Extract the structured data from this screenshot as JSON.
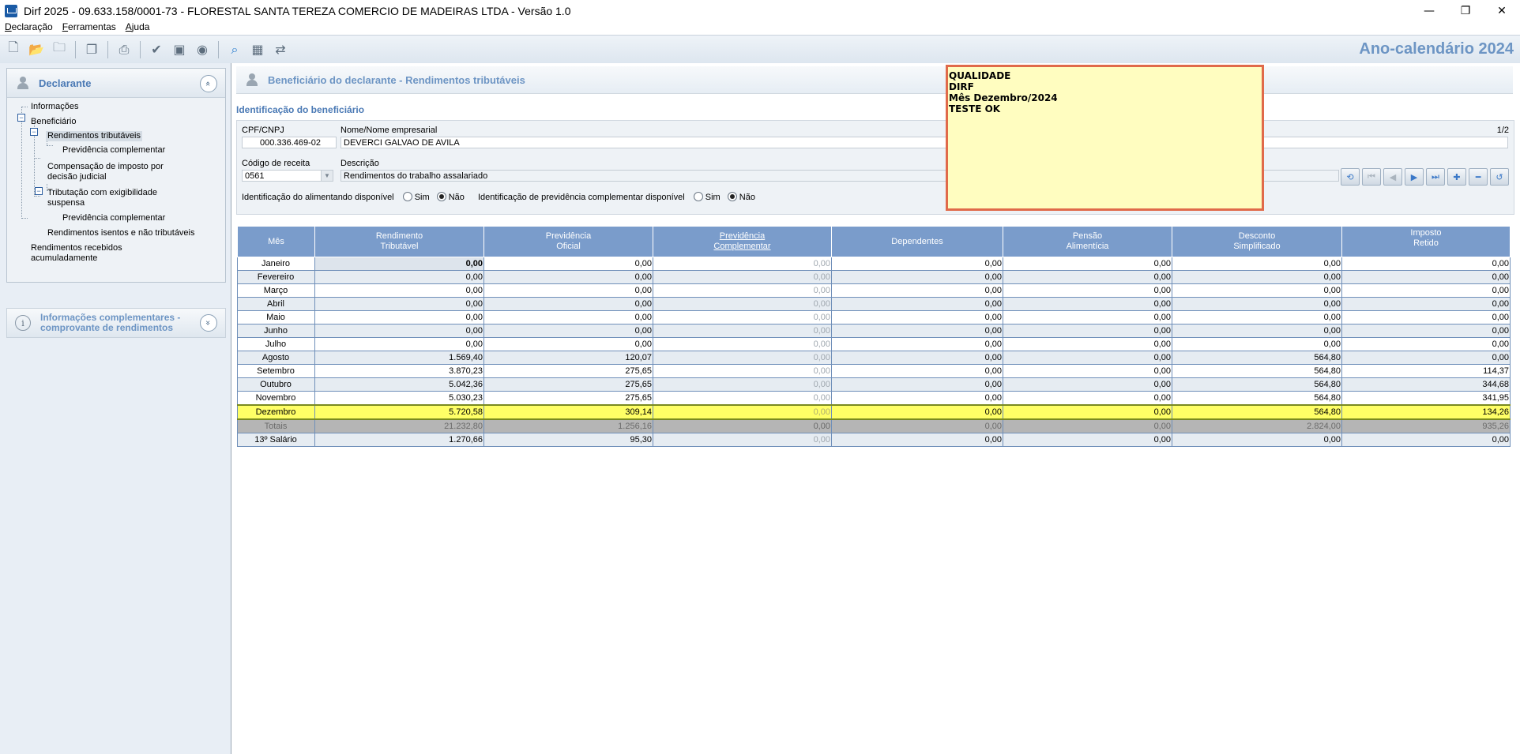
{
  "window": {
    "title": "Dirf 2025 - 09.633.158/0001-73 - FLORESTAL SANTA TEREZA COMERCIO DE MADEIRAS LTDA - Versão 1.0",
    "minimize": "—",
    "maximize": "❐",
    "close": "✕"
  },
  "menu": [
    {
      "first": "D",
      "rest": "eclaração"
    },
    {
      "first": "F",
      "rest": "erramentas"
    },
    {
      "first": "A",
      "rest": "juda"
    }
  ],
  "toolbar": {
    "year_title": "Ano-calendário 2024",
    "icons": [
      "new-icon",
      "open-icon",
      "folder-icon",
      "copy-icon",
      "print-icon",
      "check-icon",
      "save-icon",
      "export-icon",
      "search-icon",
      "calculator-icon",
      "transfer-icon"
    ]
  },
  "sidebar": {
    "declarante_title": "Declarante",
    "collapse_glyph": "«",
    "expand_glyph": "»",
    "tree": {
      "informacoes": "Informações",
      "beneficiario": "Beneficiário",
      "rendimentos_tributaveis": "Rendimentos tributáveis",
      "previdencia_complementar_1": "Previdência complementar",
      "compensacao_1": "Compensação de imposto por",
      "compensacao_2": "decisão judicial",
      "tributacao_1": "Tributação com exigibilidade",
      "tributacao_2": "suspensa",
      "previdencia_complementar_2": "Previdência complementar",
      "rendimentos_isentos": "Rendimentos isentos e não tributáveis",
      "recebidos_1": "Rendimentos recebidos",
      "recebidos_2": "acumuladamente"
    },
    "info_comp_line1": "Informações complementares -",
    "info_comp_line2": "comprovante de rendimentos"
  },
  "content": {
    "header_title": "Beneficiário do declarante - Rendimentos tributáveis",
    "section_title": "Identificação do beneficiário",
    "labels": {
      "cpf": "CPF/CNPJ",
      "nome": "Nome/Nome empresarial",
      "codigo": "Código de receita",
      "descricao": "Descrição",
      "alimentando": "Identificação do alimentando disponível",
      "previdencia": "Identificação de previdência complementar disponível",
      "sim": "Sim",
      "nao": "Não"
    },
    "values": {
      "cpf": "000.336.469-02",
      "nome": "DEVERCI GALVAO DE AVILA",
      "codigo": "0561",
      "descricao": "Rendimentos do trabalho assalariado",
      "page": "1/2"
    }
  },
  "note_lines": [
    "QUALIDADE",
    "DIRF",
    "",
    "",
    "Mês Dezembro/2024",
    "",
    "",
    "TESTE OK"
  ],
  "table": {
    "headers": [
      [
        "Mês",
        ""
      ],
      [
        "Rendimento",
        "Tributável"
      ],
      [
        "Previdência",
        "Oficial"
      ],
      [
        "Previdência",
        "Complementar"
      ],
      [
        "Dependentes",
        ""
      ],
      [
        "Pensão",
        "Alimentícia"
      ],
      [
        "Desconto",
        "Simplificado"
      ],
      [
        "Imposto",
        "Retido"
      ]
    ],
    "rows": [
      [
        "Janeiro",
        "0,00",
        "0,00",
        "0,00",
        "0,00",
        "0,00",
        "0,00",
        "0,00"
      ],
      [
        "Fevereiro",
        "0,00",
        "0,00",
        "0,00",
        "0,00",
        "0,00",
        "0,00",
        "0,00"
      ],
      [
        "Março",
        "0,00",
        "0,00",
        "0,00",
        "0,00",
        "0,00",
        "0,00",
        "0,00"
      ],
      [
        "Abril",
        "0,00",
        "0,00",
        "0,00",
        "0,00",
        "0,00",
        "0,00",
        "0,00"
      ],
      [
        "Maio",
        "0,00",
        "0,00",
        "0,00",
        "0,00",
        "0,00",
        "0,00",
        "0,00"
      ],
      [
        "Junho",
        "0,00",
        "0,00",
        "0,00",
        "0,00",
        "0,00",
        "0,00",
        "0,00"
      ],
      [
        "Julho",
        "0,00",
        "0,00",
        "0,00",
        "0,00",
        "0,00",
        "0,00",
        "0,00"
      ],
      [
        "Agosto",
        "1.569,40",
        "120,07",
        "0,00",
        "0,00",
        "0,00",
        "564,80",
        "0,00"
      ],
      [
        "Setembro",
        "3.870,23",
        "275,65",
        "0,00",
        "0,00",
        "0,00",
        "564,80",
        "114,37"
      ],
      [
        "Outubro",
        "5.042,36",
        "275,65",
        "0,00",
        "0,00",
        "0,00",
        "564,80",
        "344,68"
      ],
      [
        "Novembro",
        "5.030,23",
        "275,65",
        "0,00",
        "0,00",
        "0,00",
        "564,80",
        "341,95"
      ],
      [
        "Dezembro",
        "5.720,58",
        "309,14",
        "0,00",
        "0,00",
        "0,00",
        "564,80",
        "134,26"
      ],
      [
        "Totais",
        "21.232,80",
        "1.256,16",
        "0,00",
        "0,00",
        "0,00",
        "2.824,00",
        "935,26"
      ],
      [
        "13º Salário",
        "1.270,66",
        "95,30",
        "0,00",
        "0,00",
        "0,00",
        "0,00",
        "0,00"
      ]
    ]
  }
}
